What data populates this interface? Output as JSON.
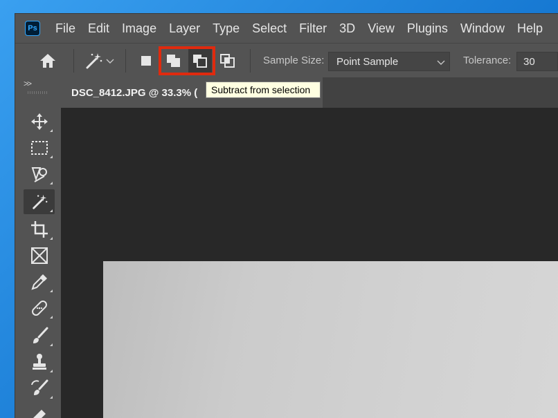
{
  "app": {
    "logo_text": "Ps",
    "menu": [
      "File",
      "Edit",
      "Image",
      "Layer",
      "Type",
      "Select",
      "Filter",
      "3D",
      "View",
      "Plugins",
      "Window",
      "Help"
    ]
  },
  "options_bar": {
    "sample_size_label": "Sample Size:",
    "sample_size_value": "Point Sample",
    "tolerance_label": "Tolerance:",
    "tolerance_value": "30",
    "selection_modes": [
      {
        "name": "new-selection",
        "icon": "new-selection-icon"
      },
      {
        "name": "add-to-selection",
        "icon": "add-to-selection-icon"
      },
      {
        "name": "subtract-from-selection",
        "icon": "subtract-from-selection-icon",
        "selected": true
      },
      {
        "name": "intersect-with-selection",
        "icon": "intersect-selection-icon"
      }
    ],
    "highlight_color": "#e02a0e"
  },
  "tooltip": {
    "text": "Subtract from selection"
  },
  "document": {
    "tab_title": "DSC_8412.JPG @ 33.3% (",
    "canvas_bg": "#282828"
  },
  "toolbox": {
    "collapse_label": ">>",
    "tools": [
      "move-tool",
      "marquee-tool",
      "object-selection-tool",
      "magic-wand-tool",
      "crop-tool",
      "frame-tool",
      "eyedropper-tool",
      "healing-brush-tool",
      "brush-tool",
      "clone-stamp-tool",
      "history-brush-tool",
      "eraser-tool"
    ],
    "active_tool": "magic-wand-tool"
  }
}
